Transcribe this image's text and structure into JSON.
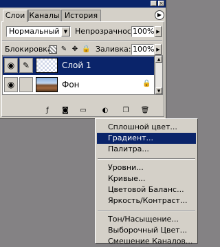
{
  "tabs": [
    "Слои",
    "Каналы",
    "История"
  ],
  "blend_mode": "Нормальный",
  "opacity_label": "Непрозрачность:",
  "opacity_value": "100%",
  "lock_label": "Блокировка:",
  "fill_label": "Заливка:",
  "fill_value": "100%",
  "layers": [
    {
      "name": "Слой 1",
      "selected": true
    },
    {
      "name": "Фон",
      "selected": false
    }
  ],
  "menu": {
    "group1": [
      "Сплошной цвет...",
      "Градиент...",
      "Палитра..."
    ],
    "group2": [
      "Уровни...",
      "Кривые...",
      "Цветовой Баланс...",
      "Яркость/Контраст..."
    ],
    "group3": [
      "Тон/Насыщение...",
      "Выборочный Цвет...",
      "Смешение Каналов..."
    ]
  },
  "colors": {
    "selection": "#0a246a",
    "panel": "#d4d0c8",
    "background": "#848284"
  }
}
